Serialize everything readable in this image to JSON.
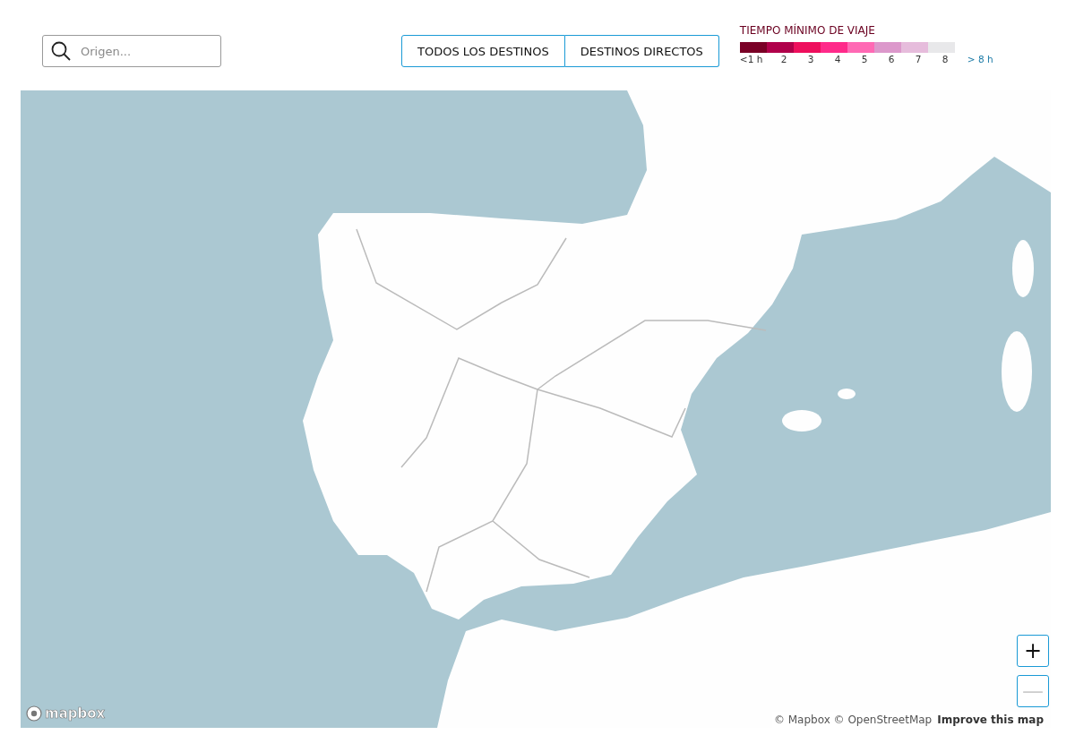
{
  "search": {
    "placeholder": "Origen..."
  },
  "filters": [
    {
      "label": "TODOS LOS DESTINOS",
      "selected": false
    },
    {
      "label": "DESTINOS DIRECTOS",
      "selected": false
    }
  ],
  "legend": {
    "title": "TIEMPO MÍNIMO DE VIAJE",
    "swatches": [
      {
        "color": "#7a0026"
      },
      {
        "color": "#b0004a"
      },
      {
        "color": "#ee0f5d"
      },
      {
        "color": "#ff2a8a"
      },
      {
        "color": "#ff69b4"
      },
      {
        "color": "#dc98cb"
      },
      {
        "color": "#e6bcdc"
      },
      {
        "color": "#e8e8ea"
      }
    ],
    "labels": [
      "<1 h",
      "2",
      "3",
      "4",
      "5",
      "6",
      "7",
      "8",
      "> 8 h"
    ]
  },
  "map": {
    "kind": "picture",
    "zoom_controls": [
      {
        "symbol": "+",
        "disabled": false
      },
      {
        "symbol": "—",
        "disabled": true
      }
    ],
    "logo": "mapbox",
    "attribution": "© Mapbox © OpenStreetMap",
    "improve_link": "Improve this map"
  }
}
